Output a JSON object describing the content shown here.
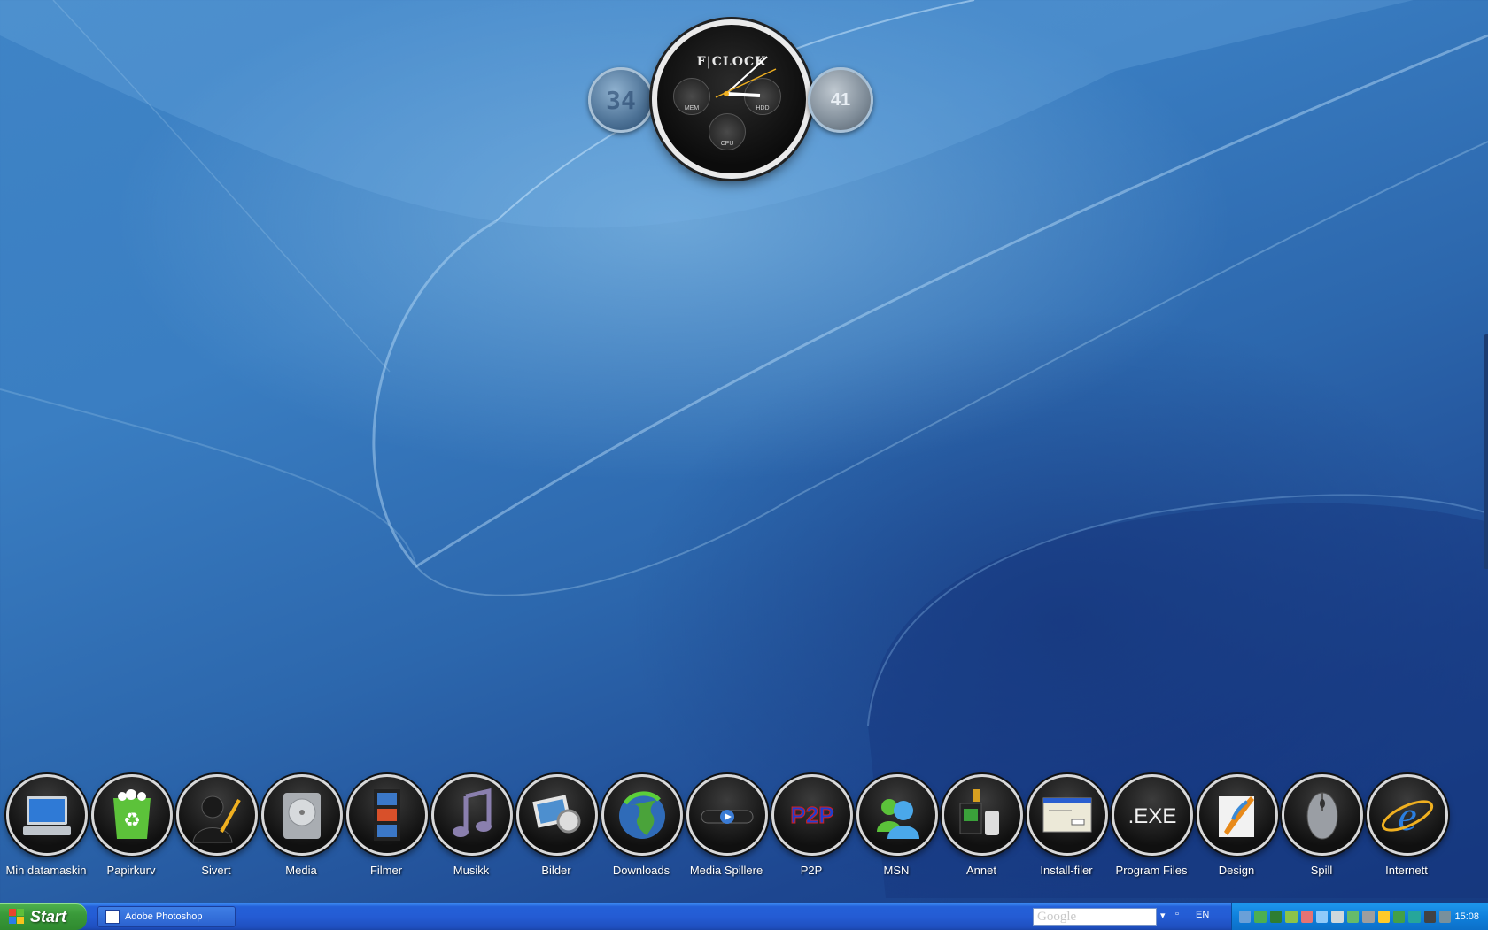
{
  "gadget": {
    "brand": "F|CLOCK",
    "left_value": "34",
    "right_value": "41",
    "subdials": [
      "MEM",
      "HDD",
      "CPU"
    ]
  },
  "dock": {
    "items": [
      {
        "label": "Min datamaskin",
        "icon": "computer-icon"
      },
      {
        "label": "Papirkurv",
        "icon": "recycle-bin-icon"
      },
      {
        "label": "Sivert",
        "icon": "user-silhouette-icon"
      },
      {
        "label": "Media",
        "icon": "hard-drive-icon"
      },
      {
        "label": "Filmer",
        "icon": "film-strip-icon"
      },
      {
        "label": "Musikk",
        "icon": "music-note-icon"
      },
      {
        "label": "Bilder",
        "icon": "photos-icon"
      },
      {
        "label": "Downloads",
        "icon": "globe-download-icon"
      },
      {
        "label": "Media Spillere",
        "icon": "media-player-icon"
      },
      {
        "label": "P2P",
        "icon": "p2p-icon",
        "icon_text": "P2P"
      },
      {
        "label": "MSN",
        "icon": "msn-icon"
      },
      {
        "label": "Annet",
        "icon": "devices-icon"
      },
      {
        "label": "Install-filer",
        "icon": "installer-window-icon"
      },
      {
        "label": "Program Files",
        "icon": "exe-icon",
        "icon_text": ".EXE"
      },
      {
        "label": "Design",
        "icon": "design-brush-icon"
      },
      {
        "label": "Spill",
        "icon": "gaming-mouse-icon"
      },
      {
        "label": "Internett",
        "icon": "internet-explorer-icon"
      }
    ]
  },
  "taskbar": {
    "start_label": "Start",
    "task_button": "Adobe Photoshop",
    "search_placeholder": "Google",
    "language": "EN",
    "clock": "15:08"
  },
  "colors": {
    "taskbar_blue": "#245cd4",
    "start_green": "#3a9a3a",
    "tray_blue": "#0f80dc"
  }
}
